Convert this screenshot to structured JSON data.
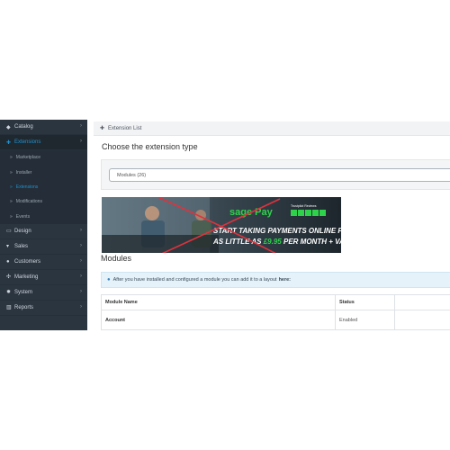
{
  "sidebar": {
    "items": [
      {
        "label": "Catalog",
        "icon": "tag-icon"
      },
      {
        "label": "Extensions",
        "icon": "puzzle-icon"
      },
      {
        "label": "Design",
        "icon": "monitor-icon"
      },
      {
        "label": "Sales",
        "icon": "cart-icon"
      },
      {
        "label": "Customers",
        "icon": "user-icon"
      },
      {
        "label": "Marketing",
        "icon": "share-icon"
      },
      {
        "label": "System",
        "icon": "gear-icon"
      },
      {
        "label": "Reports",
        "icon": "bar-chart-icon"
      }
    ],
    "sub_items": [
      "Marketplace",
      "Installer",
      "Extensions",
      "Modifications",
      "Events"
    ]
  },
  "breadcrumb": {
    "label": "Extension List"
  },
  "page": {
    "heading": "Choose the extension type"
  },
  "type_select": {
    "value": "Modules (26)"
  },
  "banner": {
    "brand": "sage Pay",
    "rating_label": "Trustpilot Reviews",
    "headline_1": "START TAKING PAYMENTS ONLINE FROM",
    "headline_2a": "AS LITTLE AS",
    "headline_2b": "£9.95",
    "headline_2c": "PER MONTH + VAT"
  },
  "modules": {
    "title": "Modules",
    "info_text": "After you have installed and configured a module you can add it to a layout",
    "info_link": "here:",
    "columns": [
      "Module Name",
      "Status"
    ],
    "rows": [
      {
        "name": "Account",
        "status": "Enabled"
      }
    ]
  },
  "colors": {
    "sidebar_bg": "#2b3540",
    "accent": "#1e91cf",
    "info_bg": "#e5f2fa",
    "sage_green": "#2fd24b",
    "cross_red": "#e0323c"
  }
}
